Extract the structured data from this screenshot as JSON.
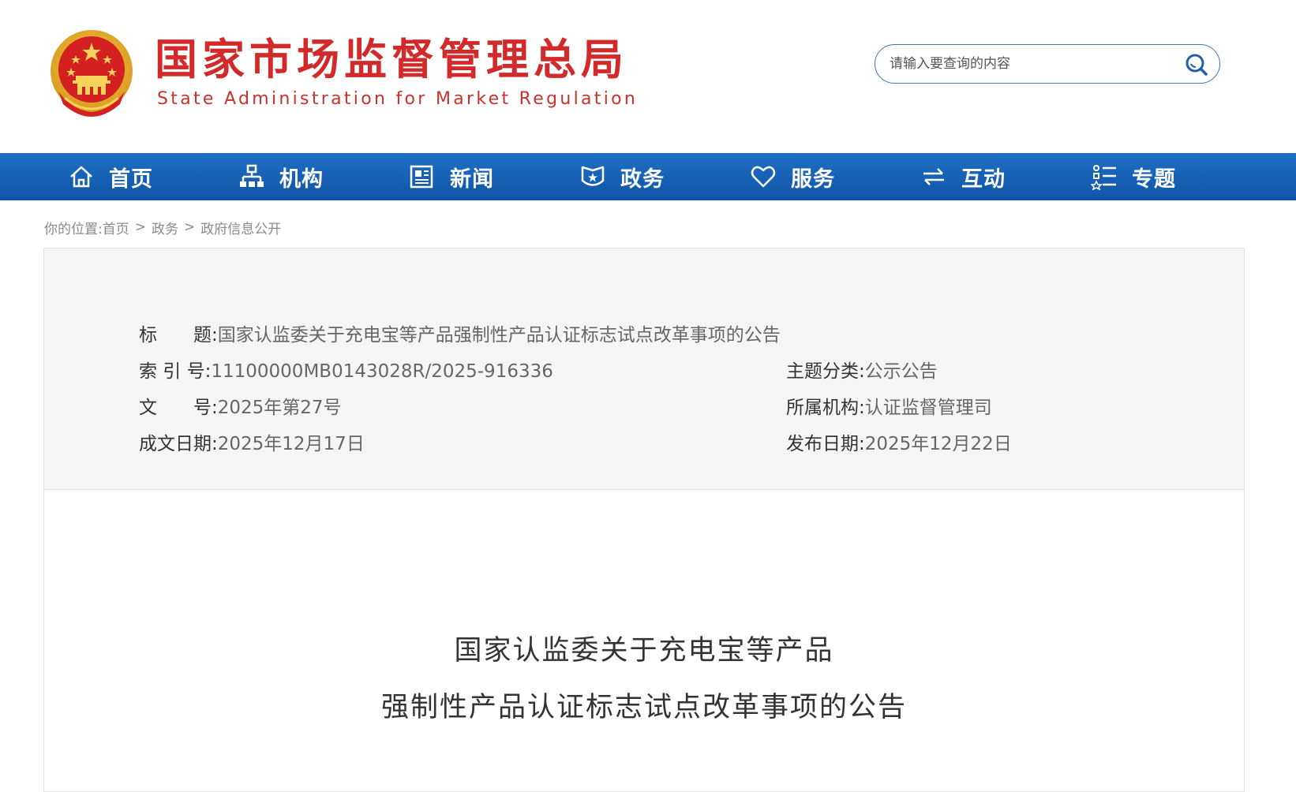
{
  "site": {
    "title_cn": "国家市场监督管理总局",
    "title_en": "State Administration for Market Regulation"
  },
  "search": {
    "placeholder": "请输入要查询的内容"
  },
  "nav": {
    "items": [
      {
        "label": "首页",
        "icon": "home-icon"
      },
      {
        "label": "机构",
        "icon": "org-chart-icon"
      },
      {
        "label": "新闻",
        "icon": "newspaper-icon"
      },
      {
        "label": "政务",
        "icon": "shield-star-icon"
      },
      {
        "label": "服务",
        "icon": "heart-icon"
      },
      {
        "label": "互动",
        "icon": "exchange-arrows-icon"
      },
      {
        "label": "专题",
        "icon": "topic-list-icon"
      }
    ]
  },
  "breadcrumb": {
    "prefix": "你的位置:",
    "items": [
      "首页",
      "政务",
      "政府信息公开"
    ],
    "separator": ">"
  },
  "meta": {
    "title_label": "标　　题:",
    "title_value": "国家认监委关于充电宝等产品强制性产品认证标志试点改革事项的公告",
    "index_label": "索 引 号:",
    "index_value": "11100000MB0143028R/2025-916336",
    "category_label": "主题分类:",
    "category_value": "公示公告",
    "docno_label": "文　　号:",
    "docno_value": "2025年第27号",
    "org_label": "所属机构:",
    "org_value": "认证监督管理司",
    "written_label": "成文日期:",
    "written_value": "2025年12月17日",
    "published_label": "发布日期:",
    "published_value": "2025年12月22日"
  },
  "article": {
    "title_line1": "国家认监委关于充电宝等产品",
    "title_line2": "强制性产品认证标志试点改革事项的公告"
  },
  "colors": {
    "brand_red": "#d22a2a",
    "nav_blue": "#1054a8",
    "search_border": "#3f78b4"
  }
}
